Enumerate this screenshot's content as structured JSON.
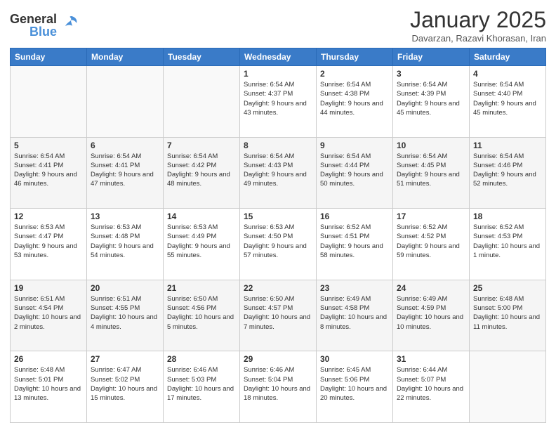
{
  "header": {
    "logo_general": "General",
    "logo_blue": "Blue",
    "month_title": "January 2025",
    "location": "Davarzan, Razavi Khorasan, Iran"
  },
  "days_of_week": [
    "Sunday",
    "Monday",
    "Tuesday",
    "Wednesday",
    "Thursday",
    "Friday",
    "Saturday"
  ],
  "weeks": [
    [
      {
        "day": "",
        "info": ""
      },
      {
        "day": "",
        "info": ""
      },
      {
        "day": "",
        "info": ""
      },
      {
        "day": "1",
        "info": "Sunrise: 6:54 AM\nSunset: 4:37 PM\nDaylight: 9 hours and 43 minutes."
      },
      {
        "day": "2",
        "info": "Sunrise: 6:54 AM\nSunset: 4:38 PM\nDaylight: 9 hours and 44 minutes."
      },
      {
        "day": "3",
        "info": "Sunrise: 6:54 AM\nSunset: 4:39 PM\nDaylight: 9 hours and 45 minutes."
      },
      {
        "day": "4",
        "info": "Sunrise: 6:54 AM\nSunset: 4:40 PM\nDaylight: 9 hours and 45 minutes."
      }
    ],
    [
      {
        "day": "5",
        "info": "Sunrise: 6:54 AM\nSunset: 4:41 PM\nDaylight: 9 hours and 46 minutes."
      },
      {
        "day": "6",
        "info": "Sunrise: 6:54 AM\nSunset: 4:41 PM\nDaylight: 9 hours and 47 minutes."
      },
      {
        "day": "7",
        "info": "Sunrise: 6:54 AM\nSunset: 4:42 PM\nDaylight: 9 hours and 48 minutes."
      },
      {
        "day": "8",
        "info": "Sunrise: 6:54 AM\nSunset: 4:43 PM\nDaylight: 9 hours and 49 minutes."
      },
      {
        "day": "9",
        "info": "Sunrise: 6:54 AM\nSunset: 4:44 PM\nDaylight: 9 hours and 50 minutes."
      },
      {
        "day": "10",
        "info": "Sunrise: 6:54 AM\nSunset: 4:45 PM\nDaylight: 9 hours and 51 minutes."
      },
      {
        "day": "11",
        "info": "Sunrise: 6:54 AM\nSunset: 4:46 PM\nDaylight: 9 hours and 52 minutes."
      }
    ],
    [
      {
        "day": "12",
        "info": "Sunrise: 6:53 AM\nSunset: 4:47 PM\nDaylight: 9 hours and 53 minutes."
      },
      {
        "day": "13",
        "info": "Sunrise: 6:53 AM\nSunset: 4:48 PM\nDaylight: 9 hours and 54 minutes."
      },
      {
        "day": "14",
        "info": "Sunrise: 6:53 AM\nSunset: 4:49 PM\nDaylight: 9 hours and 55 minutes."
      },
      {
        "day": "15",
        "info": "Sunrise: 6:53 AM\nSunset: 4:50 PM\nDaylight: 9 hours and 57 minutes."
      },
      {
        "day": "16",
        "info": "Sunrise: 6:52 AM\nSunset: 4:51 PM\nDaylight: 9 hours and 58 minutes."
      },
      {
        "day": "17",
        "info": "Sunrise: 6:52 AM\nSunset: 4:52 PM\nDaylight: 9 hours and 59 minutes."
      },
      {
        "day": "18",
        "info": "Sunrise: 6:52 AM\nSunset: 4:53 PM\nDaylight: 10 hours and 1 minute."
      }
    ],
    [
      {
        "day": "19",
        "info": "Sunrise: 6:51 AM\nSunset: 4:54 PM\nDaylight: 10 hours and 2 minutes."
      },
      {
        "day": "20",
        "info": "Sunrise: 6:51 AM\nSunset: 4:55 PM\nDaylight: 10 hours and 4 minutes."
      },
      {
        "day": "21",
        "info": "Sunrise: 6:50 AM\nSunset: 4:56 PM\nDaylight: 10 hours and 5 minutes."
      },
      {
        "day": "22",
        "info": "Sunrise: 6:50 AM\nSunset: 4:57 PM\nDaylight: 10 hours and 7 minutes."
      },
      {
        "day": "23",
        "info": "Sunrise: 6:49 AM\nSunset: 4:58 PM\nDaylight: 10 hours and 8 minutes."
      },
      {
        "day": "24",
        "info": "Sunrise: 6:49 AM\nSunset: 4:59 PM\nDaylight: 10 hours and 10 minutes."
      },
      {
        "day": "25",
        "info": "Sunrise: 6:48 AM\nSunset: 5:00 PM\nDaylight: 10 hours and 11 minutes."
      }
    ],
    [
      {
        "day": "26",
        "info": "Sunrise: 6:48 AM\nSunset: 5:01 PM\nDaylight: 10 hours and 13 minutes."
      },
      {
        "day": "27",
        "info": "Sunrise: 6:47 AM\nSunset: 5:02 PM\nDaylight: 10 hours and 15 minutes."
      },
      {
        "day": "28",
        "info": "Sunrise: 6:46 AM\nSunset: 5:03 PM\nDaylight: 10 hours and 17 minutes."
      },
      {
        "day": "29",
        "info": "Sunrise: 6:46 AM\nSunset: 5:04 PM\nDaylight: 10 hours and 18 minutes."
      },
      {
        "day": "30",
        "info": "Sunrise: 6:45 AM\nSunset: 5:06 PM\nDaylight: 10 hours and 20 minutes."
      },
      {
        "day": "31",
        "info": "Sunrise: 6:44 AM\nSunset: 5:07 PM\nDaylight: 10 hours and 22 minutes."
      },
      {
        "day": "",
        "info": ""
      }
    ]
  ]
}
